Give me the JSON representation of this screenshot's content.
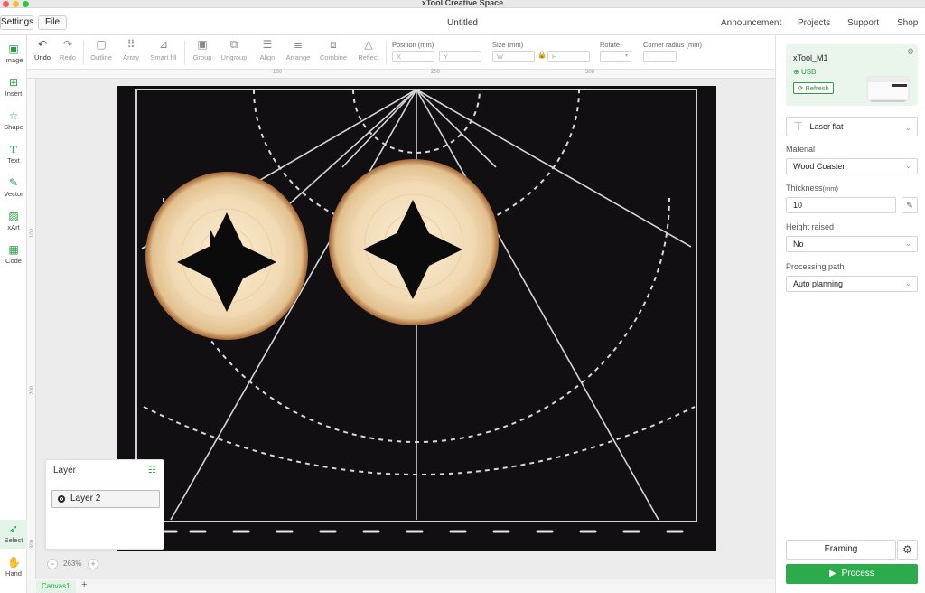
{
  "app_title": "xTool Creative Space",
  "menubar": {
    "settings": "Settings",
    "file": "File",
    "doc_title": "Untitled",
    "nav": [
      "Announcement",
      "Projects",
      "Support",
      "Shop"
    ]
  },
  "toolbar": {
    "undo": "Undo",
    "redo": "Redo",
    "outline": "Outline",
    "array": "Array",
    "smart_fill": "Smart fill",
    "group": "Group",
    "ungroup": "Ungroup",
    "align": "Align",
    "arrange": "Arrange",
    "combine": "Combine",
    "reflect": "Reflect",
    "position_label": "Position (mm)",
    "x_placeholder": "X",
    "y_placeholder": "Y",
    "size_label": "Size (mm)",
    "w_placeholder": "W",
    "h_placeholder": "H",
    "rotate_label": "Rotate",
    "corner_label": "Corner radius (mm)"
  },
  "sidebar": {
    "items": [
      "Image",
      "Insert",
      "Shape",
      "Text",
      "Vector",
      "xArt",
      "Code"
    ],
    "bottom": [
      "Select",
      "Hand"
    ]
  },
  "rulers": {
    "top": [
      "100",
      "200",
      "300"
    ],
    "left": [
      "100",
      "200",
      "300"
    ]
  },
  "layer_panel": {
    "title": "Layer",
    "layers": [
      "Layer 2"
    ]
  },
  "zoom": {
    "level": "263%"
  },
  "canvas_tabs": {
    "tab": "Canvas1",
    "add": "+"
  },
  "right_panel": {
    "device_name": "xTool_M1",
    "connection": "USB",
    "refresh": "Refresh",
    "mode": "Laser flat",
    "material_label": "Material",
    "material": "Wood Coaster",
    "thickness_label": "Thickness",
    "thickness_unit": "(mm)",
    "thickness": "10",
    "height_label": "Height raised",
    "height": "No",
    "path_label": "Processing path",
    "path": "Auto planning",
    "framing": "Framing",
    "process": "Process"
  },
  "colors": {
    "accent": "#2daa4b",
    "canvas_bg": "#0f0d0f",
    "wood": "#f3dfbf"
  }
}
